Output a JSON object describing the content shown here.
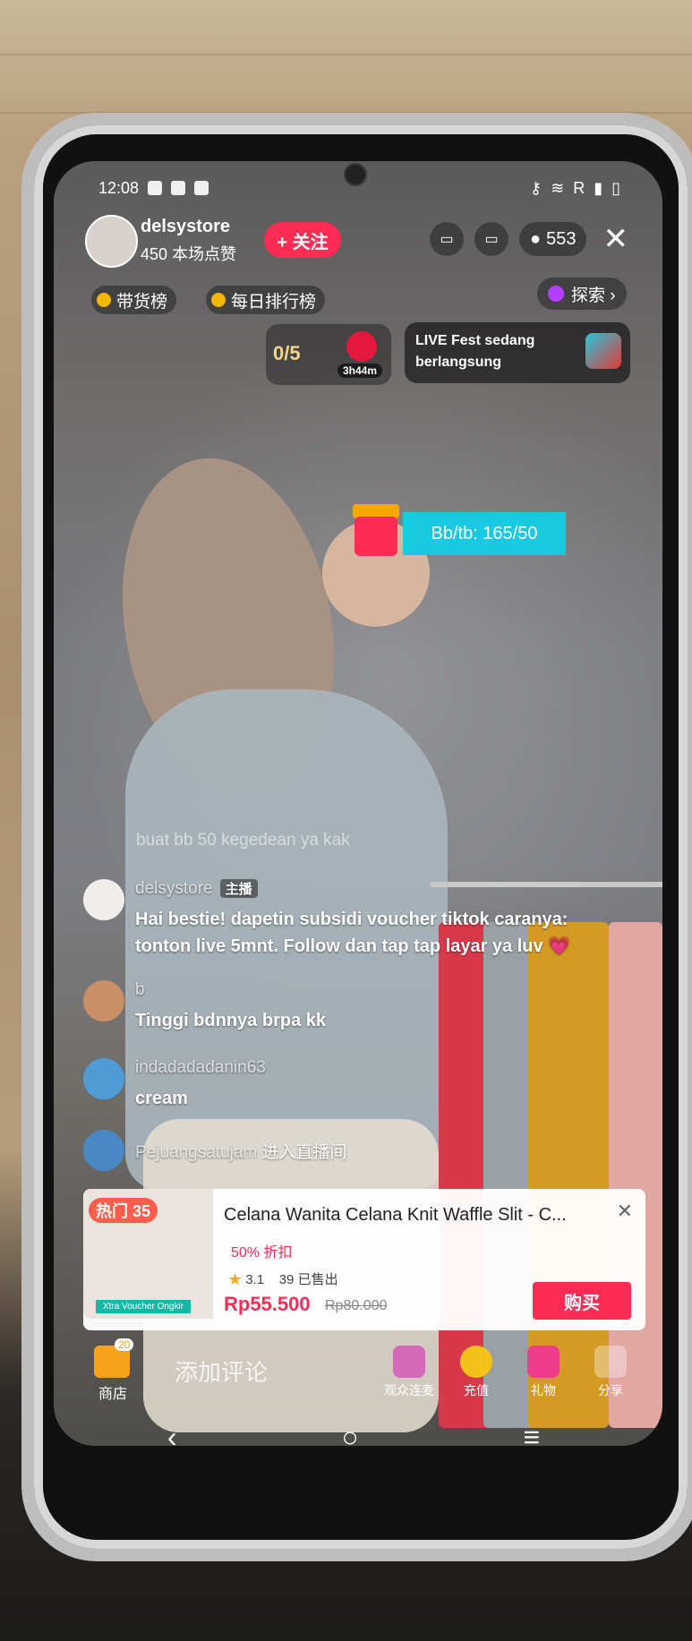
{
  "status_bar": {
    "time": "12:08",
    "carrier": "R"
  },
  "header": {
    "store_name": "delsystore",
    "likes": "450 本场点赞",
    "follow_label": "+ 关注",
    "viewer_count": "553",
    "close": "✕"
  },
  "chips": {
    "rank1": "带货榜",
    "rank2": "每日排行榜",
    "explore": "探索 ›"
  },
  "gift_counter": {
    "value": "0/5",
    "timer": "3h44m"
  },
  "fest_banner": {
    "line1": "LIVE Fest sedang",
    "line2": "berlangsung"
  },
  "bb_pill": "Bb/tb: 165/50",
  "faded_comment": "buat bb 50 kegedean ya kak",
  "chat": [
    {
      "user": "delsystore",
      "tag": "主播",
      "message": "Hai bestie! dapetin subsidi voucher tiktok caranya: tonton live 5mnt. Follow dan tap tap layar ya luv 💗"
    },
    {
      "user": "b",
      "message": "Tinggi bdnnya brpa kk"
    },
    {
      "user": "indadadadanin63",
      "message": "cream"
    },
    {
      "user": "Pejuangsatujam",
      "message": "进入直播间"
    }
  ],
  "product": {
    "hot_label": "热门 35",
    "xtra_label": "Xtra Voucher Ongkir",
    "title": "Celana  Wanita Celana Knit Waffle Slit - C...",
    "discount": "50% 折扣",
    "rating": "3.1",
    "sold": "39 已售出",
    "price": "Rp55.500",
    "old_price": "Rp80.000",
    "buy_label": "购买"
  },
  "bottom_bar": {
    "shop_badge": "20",
    "shop_label": "商店",
    "comment_placeholder": "添加评论",
    "items": [
      {
        "label": "观众连麦"
      },
      {
        "label": "充值"
      },
      {
        "label": "礼物"
      },
      {
        "label": "分享"
      }
    ]
  },
  "nav": {
    "back": "‹",
    "home": "○",
    "menu": "≡"
  }
}
